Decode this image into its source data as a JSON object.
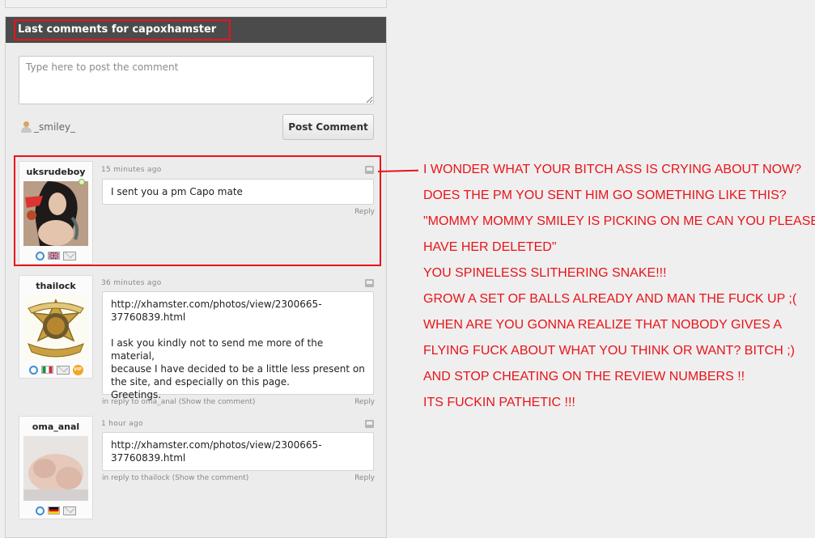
{
  "panel": {
    "title": "Last comments for capoxhamster"
  },
  "composer": {
    "placeholder": "Type here to post the comment",
    "username": "_smiley_",
    "post_button": "Post Comment"
  },
  "comments": [
    {
      "author": "uksrudeboy",
      "time": "15 minutes ago",
      "lines": [
        "I sent you a pm Capo mate"
      ],
      "reply": "Reply",
      "flag": "uk-flag"
    },
    {
      "author": "thailock",
      "time": "36 minutes ago",
      "lines": [
        "http://xhamster.com/photos/view/2300665-",
        "37760839.html",
        "",
        "I ask you kindly not to send me more of the material,",
        "because I have decided to be a little less present on",
        "the site, and especially on this page.",
        "Greetings."
      ],
      "in_reply": "in reply to oma_anal (Show the comment)",
      "reply": "Reply",
      "flag": "italy-flag"
    },
    {
      "author": "oma_anal",
      "time": "1 hour ago",
      "lines": [
        "http://xhamster.com/photos/view/2300665-",
        "37760839.html"
      ],
      "in_reply": "in reply to thailock (Show the comment)",
      "reply": "Reply",
      "flag": "germany-flag"
    }
  ],
  "annotation": {
    "lines": [
      "I WONDER WHAT YOUR BITCH ASS IS CRYING ABOUT NOW?",
      "DOES THE PM YOU SENT HIM GO SOMETHING LIKE THIS?",
      "\"MOMMY MOMMY SMILEY IS PICKING ON ME CAN YOU PLEASE",
      "HAVE HER DELETED\"",
      "YOU SPINELESS SLITHERING SNAKE!!!",
      "GROW A SET OF BALLS ALREADY AND MAN THE FUCK UP ;(",
      "WHEN ARE YOU GONNA REALIZE THAT NOBODY GIVES A",
      "FLYING FUCK ABOUT WHAT YOU THINK OR WANT?  BITCH ;)",
      "AND STOP CHEATING ON THE REVIEW NUMBERS !!",
      "ITS FUCKIN PATHETIC !!!"
    ]
  },
  "colors": {
    "annotation_red": "#e8141a",
    "header_bg": "#4b4b4b"
  },
  "badges": {
    "vip": "VIP"
  }
}
